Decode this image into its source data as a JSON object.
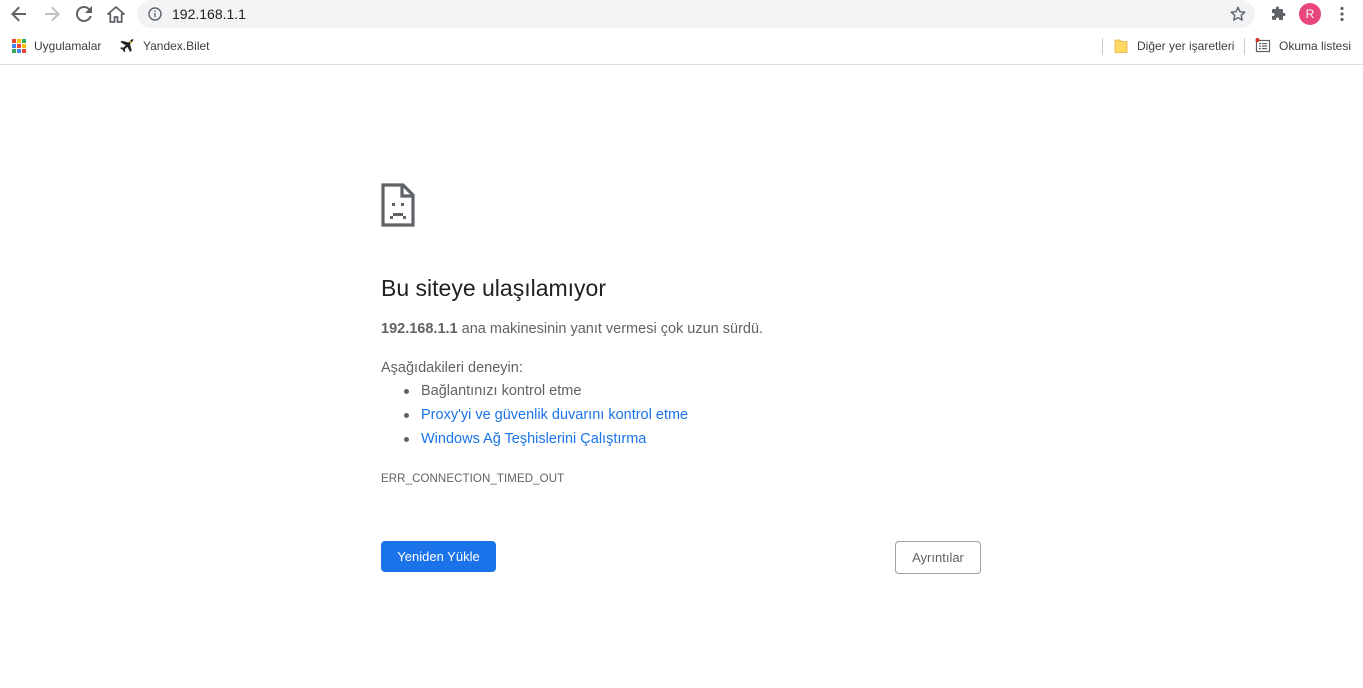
{
  "toolbar": {
    "back_icon": "arrow-left-icon",
    "forward_icon": "arrow-right-icon",
    "reload_icon": "reload-icon",
    "home_icon": "home-icon",
    "url": "192.168.1.1",
    "avatar_letter": "R",
    "avatar_color": "#e8467c"
  },
  "bookmarks": {
    "apps_label": "Uygulamalar",
    "items": [
      {
        "label": "Yandex.Bilet",
        "icon": "plane-icon"
      }
    ],
    "other_label": "Diğer yer işaretleri",
    "reading_list_label": "Okuma listesi"
  },
  "error": {
    "title": "Bu siteye ulaşılamıyor",
    "host": "192.168.1.1",
    "description": "ana makinesinin yanıt vermesi çok uzun sürdü.",
    "try_heading": "Aşağıdakileri deneyin:",
    "suggestions": [
      {
        "text": "Bağlantınızı kontrol etme",
        "link": false
      },
      {
        "text": "Proxy'yi ve güvenlik duvarını kontrol etme",
        "link": true
      },
      {
        "text": "Windows Ağ Teşhislerini Çalıştırma",
        "link": true
      }
    ],
    "code": "ERR_CONNECTION_TIMED_OUT",
    "reload_label": "Yeniden Yükle",
    "details_label": "Ayrıntılar"
  },
  "colors": {
    "accent": "#1a73e8",
    "text_primary": "#202124",
    "text_secondary": "#5f6368"
  }
}
